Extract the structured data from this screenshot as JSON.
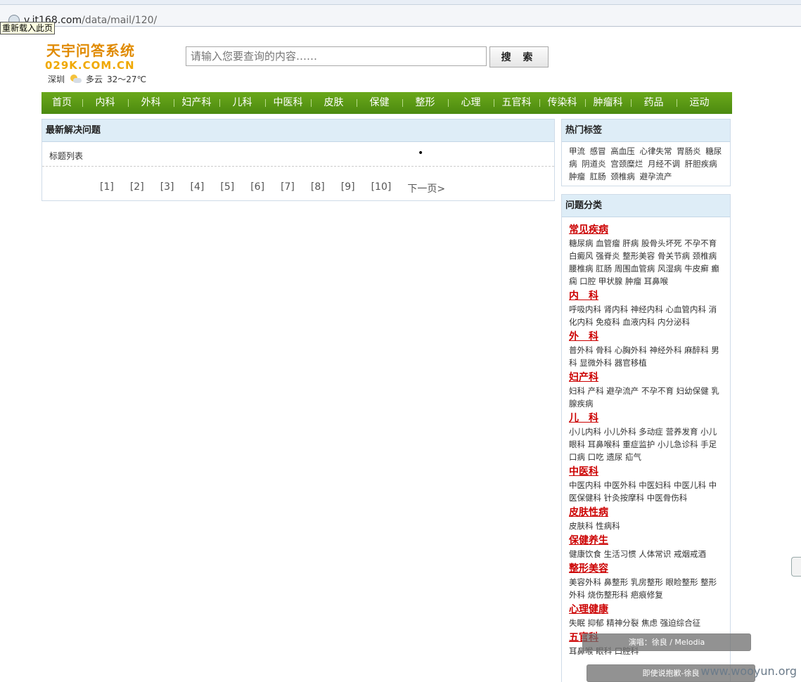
{
  "browser": {
    "url_host": "v.it168.com",
    "url_path": "/data/mail/120/",
    "tooltip": "重新载入此页"
  },
  "header": {
    "logo_cn": "天宇问答系统",
    "logo_en": "029K.COM.CN",
    "weather_city": "深圳",
    "weather_cond": "多云",
    "weather_temp": "32～27℃",
    "search_placeholder": "请输入您要查询的内容……",
    "search_button": "搜 索"
  },
  "nav": [
    "首页",
    "内科",
    "外科",
    "妇产科",
    "儿科",
    "中医科",
    "皮肤",
    "保健",
    "整形",
    "心理",
    "五官科",
    "传染科",
    "肿瘤科",
    "药品",
    "运动"
  ],
  "main": {
    "title": "最新解决问题",
    "list_label": "标题列表",
    "list_dot": "•",
    "pages": [
      "[1]",
      "[2]",
      "[3]",
      "[4]",
      "[5]",
      "[6]",
      "[7]",
      "[8]",
      "[9]",
      "[10]"
    ],
    "next": "下一页>"
  },
  "hot_tags": {
    "title": "热门标签",
    "text": "甲流 感冒 高血压 心律失常 胃肠炎 糖尿病 阴道炎 宫颈糜烂 月经不调 肝胆疾病 肿瘤 肛肠 颈椎病 避孕流产"
  },
  "categories": {
    "title": "问题分类",
    "items": [
      {
        "name": "常见疾病",
        "sub": "糖尿病 血管瘤 肝病 股骨头坏死 不孕不育 白癜风 强脊炎 整形美容 骨关节病 颈椎病 腰椎病 肛肠 周围血管病 风湿病 牛皮癣 癫痫 口腔 甲状腺 肿瘤 耳鼻喉"
      },
      {
        "name": "内　科",
        "sub": "呼吸内科 肾内科 神经内科 心血管内科 消化内科 免疫科 血液内科 内分泌科"
      },
      {
        "name": "外　科",
        "sub": "普外科 骨科 心胸外科 神经外科 麻醉科 男科 显微外科 器官移植"
      },
      {
        "name": "妇产科",
        "sub": "妇科 产科 避孕流产 不孕不育 妇幼保健 乳腺疾病"
      },
      {
        "name": "儿　科",
        "sub": "小儿内科 小儿外科 多动症 营养发育 小儿眼科 耳鼻喉科 重症监护 小儿急诊科 手足口病 口吃 遗尿 疝气"
      },
      {
        "name": "中医科",
        "sub": "中医内科 中医外科 中医妇科 中医儿科 中医保健科 针灸按摩科 中医骨伤科"
      },
      {
        "name": "皮肤性病",
        "sub": "皮肤科 性病科"
      },
      {
        "name": "保健养生",
        "sub": "健康饮食 生活习惯 人体常识 戒烟戒酒"
      },
      {
        "name": "整形美容",
        "sub": "美容外科 鼻整形 乳房整形 眼睑整形 整形外科 烧伤整形科 疤痕修复"
      },
      {
        "name": "心理健康",
        "sub": "失眠 抑郁 精神分裂 焦虑 强迫综合征"
      },
      {
        "name": "五官科",
        "sub": "耳鼻喉 眼科 口腔科"
      }
    ]
  },
  "overlays": {
    "music1": "演唱：徐良 / Melodia",
    "music2": "即使说抱歉-徐良",
    "watermark": "www.wooyun.org"
  }
}
